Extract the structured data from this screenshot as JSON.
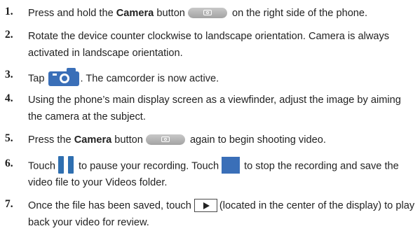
{
  "steps": [
    {
      "number": "1.",
      "text_before": "Press and hold the ",
      "bold": "Camera",
      "text_middle": " button",
      "icon": "camera-button-icon",
      "text_after": " on the right side of the phone."
    },
    {
      "number": "2.",
      "text": "Rotate the device counter clockwise to landscape orientation. Camera is always activated in landscape orientation."
    },
    {
      "number": "3.",
      "text_before": "Tap",
      "icon": "camera-glyph-icon",
      "text_after": ". The camcorder is now active."
    },
    {
      "number": "4.",
      "text": "Using the phone’s main display screen as a viewfinder, adjust the image by aiming the camera at the subject."
    },
    {
      "number": "5.",
      "text_before": "Press the ",
      "bold": "Camera",
      "text_middle": " button",
      "icon": "camera-button-icon",
      "text_after": " again to begin shooting video."
    },
    {
      "number": "6.",
      "text_before": "Touch",
      "icon": "pause-icon",
      "text_middle": "to pause your recording. Touch",
      "icon2": "stop-icon",
      "text_after": "to stop the recording and save the video file to your Videos folder."
    },
    {
      "number": "7.",
      "text_before": "Once the file has been saved, touch",
      "icon": "play-icon",
      "text_after": "(located in the center of the display) to play back your video for review."
    }
  ],
  "colors": {
    "text": "#222222",
    "accent_blue": "#3a6fb8",
    "icon_gray": "#b5b5b5"
  }
}
